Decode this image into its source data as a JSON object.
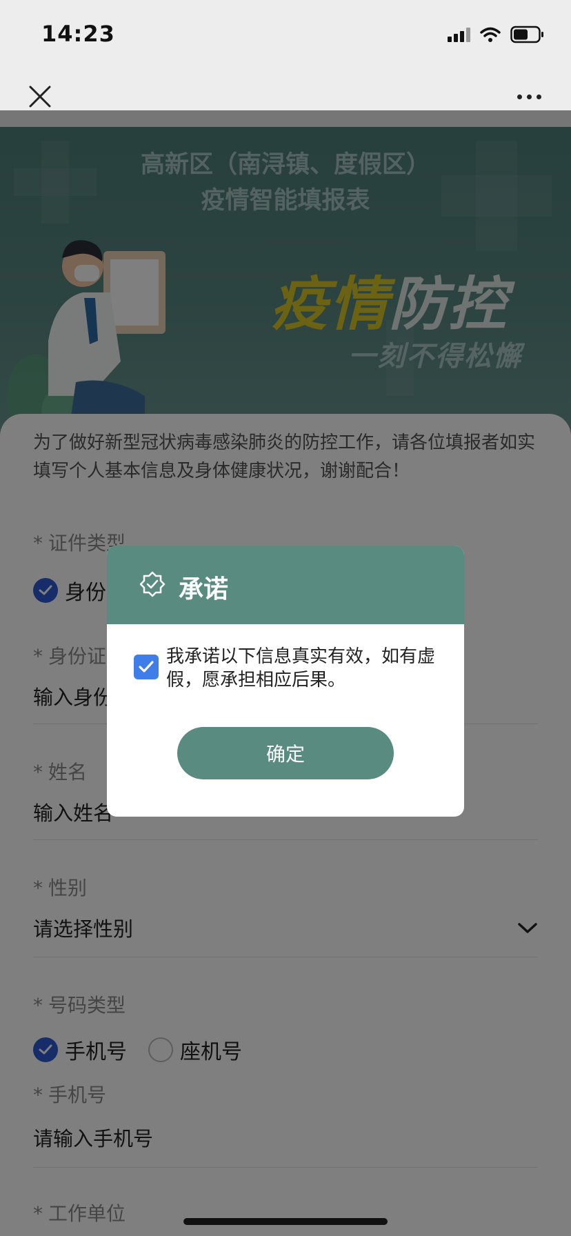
{
  "status_bar": {
    "time": "14:23"
  },
  "banner": {
    "title_line1": "高新区（南浔镇、度假区）",
    "title_line2": "疫情智能填报表",
    "slogan_yellow": "疫情",
    "slogan_white": "防控",
    "slogan_sub": "一刻不得松懈"
  },
  "intro": "为了做好新型冠状病毒感染肺炎的防控工作，请各位填报者如实填写个人基本信息及身体健康状况，谢谢配合！",
  "form": {
    "required_mark": "*",
    "id_type": {
      "label": "证件类型",
      "option_selected": "身份"
    },
    "id_number": {
      "label": "身份证",
      "placeholder": "输入身份"
    },
    "name": {
      "label": "姓名",
      "placeholder": "输入姓名"
    },
    "gender": {
      "label": "性别",
      "placeholder": "请选择性别"
    },
    "number_type": {
      "label": "号码类型",
      "options": [
        "手机号",
        "座机号"
      ],
      "selected": "手机号"
    },
    "phone": {
      "label": "手机号",
      "placeholder": "请输入手机号"
    },
    "work_unit": {
      "label": "工作单位"
    }
  },
  "dialog": {
    "title": "承诺",
    "statement": "我承诺以下信息真实有效，如有虚假，愿承担相应后果。",
    "checked": true,
    "confirm_label": "确定"
  },
  "colors": {
    "accent": "#5a8b81",
    "checkbox": "#3f7ee8",
    "radio_on": "#2f5bd3",
    "slogan_yellow": "#d8c428"
  },
  "icons": [
    "close-icon",
    "more-icon",
    "badge-check-icon",
    "checkmark-icon",
    "chevron-down-icon",
    "wifi-icon",
    "battery-icon",
    "signal-icon"
  ]
}
